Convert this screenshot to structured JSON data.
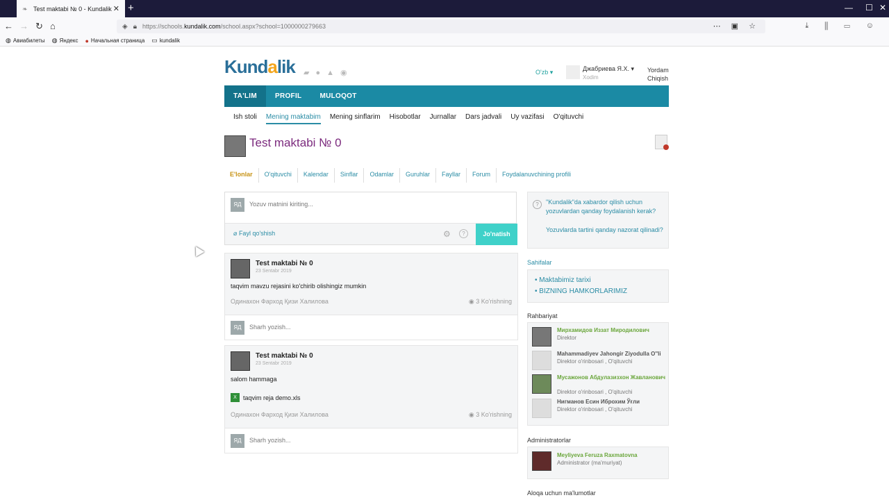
{
  "browser": {
    "tab_title": "Test maktabi № 0 - Kundalik",
    "new_tab": "+",
    "url_prefix": "https://schools.",
    "url_domain": "kundalik.com",
    "url_path": "/school.aspx?school=1000000279663",
    "bookmarks": [
      "Авиабилеты",
      "Яндекс",
      "Начальная страница",
      "kundalik"
    ]
  },
  "header": {
    "logo_text": "Kund",
    "logo_dot": "a",
    "logo_rest": "lik",
    "language": "O'zb",
    "user_name": "Джабриева Я.Х.",
    "user_role": "Xodim",
    "help_link": "Yordam",
    "logout_link": "Chiqish"
  },
  "mainnav": [
    "TA'LIM",
    "PROFIL",
    "MULOQOT"
  ],
  "subnav": [
    "Ish stoli",
    "Mening maktabim",
    "Mening sinflarim",
    "Hisobotlar",
    "Jurnallar",
    "Dars jadvali",
    "Uy vazifasi",
    "O'qituvchi"
  ],
  "school_title": "Test maktabi № 0",
  "tabs": [
    "E'lonlar",
    "O'qituvchi",
    "Kalendar",
    "Sinflar",
    "Odamlar",
    "Guruhlar",
    "Fayllar",
    "Forum",
    "Foydalanuvchining profili"
  ],
  "composer": {
    "badge": "ЯД",
    "placeholder": "Yozuv matnini kiriting...",
    "attach_label": "Fayl qo'shish",
    "send_label": "Jo'natish"
  },
  "posts": [
    {
      "name": "Test maktabi № 0",
      "date": "23 Sentabr 2019",
      "text": "taqvim mavzu rejasini ko'chirib olishingiz mumkin",
      "author": "Одинахон Фарход Қизи Халилова",
      "views": "3 Ko'rishning",
      "comment_placeholder": "Sharh yozish...",
      "comment_badge": "ЯД"
    },
    {
      "name": "Test maktabi № 0",
      "date": "23 Sentabr 2019",
      "text": "salom hammaga",
      "file": "taqvim reja demo.xls",
      "author": "Одинахон Фарход Қизи Халилова",
      "views": "3 Ko'rishning",
      "comment_placeholder": "Sharh yozish...",
      "comment_badge": "ЯД"
    }
  ],
  "sidebar": {
    "help_link1": "\"Kundalik\"da xabardor qilish uchun yozuvlardan qanday foydalanish kerak?",
    "help_link2": "Yozuvlarda tartini qanday nazorat qilinadi?",
    "pages_header": "Sahifalar",
    "pages": [
      "Maktabimiz tarixi",
      "BIZNING HAMKORLARIMIZ"
    ],
    "leadership_header": "Rahbariyat",
    "leaders": [
      {
        "name": "Мирхамидов Иззат Миродилович",
        "role": "Direktor"
      },
      {
        "name": "Mahammadiyev Jahongir Ziyodulla O''li",
        "role": "Direktor o'rinbosari , O'qituvchi"
      },
      {
        "name": "Мусажонов Абдулазизхон Жавланович",
        "role": "Direktor o'rinbosari , O'qituvchi"
      },
      {
        "name": "Нигманов Есин Иброхим Ўғли",
        "role": "Direktor o'rinbosari , O'qituvchi"
      }
    ],
    "admins_header": "Administratorlar",
    "admin": {
      "name": "Meyliyeva Feruza Raxmatovna",
      "role": "Administrator (ma'muriyat)"
    },
    "contact_header": "Aloqa uchun ma'lumotlar"
  }
}
